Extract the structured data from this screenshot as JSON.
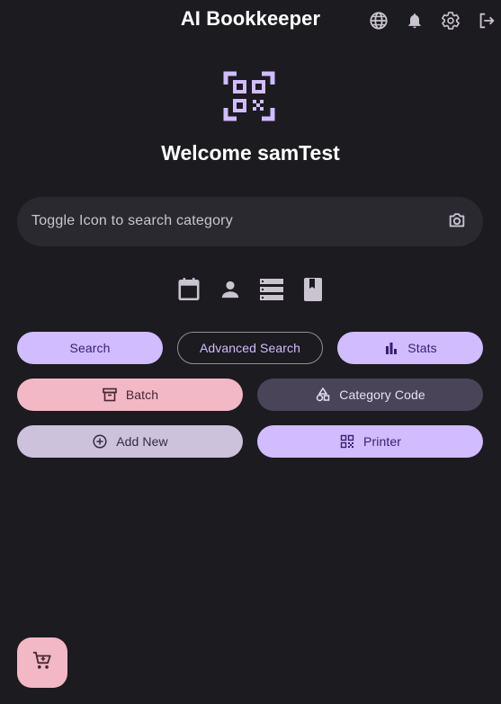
{
  "header": {
    "title": "AI Bookkeeper",
    "actions": [
      {
        "icon": "globe-icon"
      },
      {
        "icon": "bell-icon"
      },
      {
        "icon": "gear-icon"
      },
      {
        "icon": "logout-icon"
      }
    ]
  },
  "hero": {
    "icon": "qr-scan-icon",
    "welcome": "Welcome samTest"
  },
  "search": {
    "placeholder": "Toggle Icon to search category",
    "icon": "camera-icon"
  },
  "toggles": [
    {
      "icon": "calendar-icon"
    },
    {
      "icon": "person-icon"
    },
    {
      "icon": "storage-icon"
    },
    {
      "icon": "book-icon"
    }
  ],
  "buttons": {
    "search": "Search",
    "advanced_search": "Advanced Search",
    "stats": "Stats",
    "batch": "Batch",
    "category_code": "Category Code",
    "add_new": "Add New",
    "printer": "Printer"
  },
  "fab": {
    "icon": "cart-icon"
  },
  "colors": {
    "background": "#1c1b1f",
    "primary": "#d0bcff",
    "tertiary": "#f2b8c6",
    "secondary_container": "#4a4458",
    "secondary": "#ccc2dc",
    "surface_variant": "#2b2930"
  }
}
